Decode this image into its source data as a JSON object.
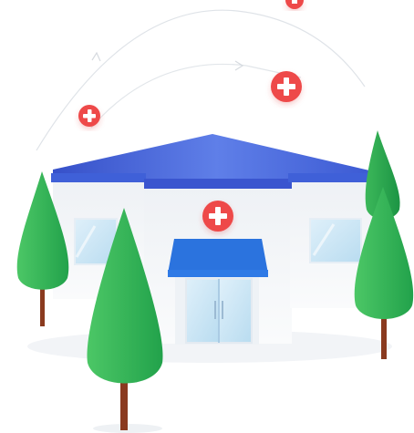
{
  "illustration": {
    "subject": "hospital-building",
    "icons": [
      "medical-cross-icon",
      "medical-cross-icon",
      "medical-cross-icon",
      "medical-cross-icon"
    ],
    "colors": {
      "roof": "#3f5fd6",
      "roof_light": "#6f8df0",
      "awning": "#2a74e0",
      "wall": "#f3f5f8",
      "window": "#cfe6f6",
      "cross_badge": "#ef4b4b",
      "tree_dark": "#1f9e4a",
      "tree_light": "#47c163",
      "trunk": "#8a3a1f",
      "arc": "#d9dde3"
    }
  }
}
